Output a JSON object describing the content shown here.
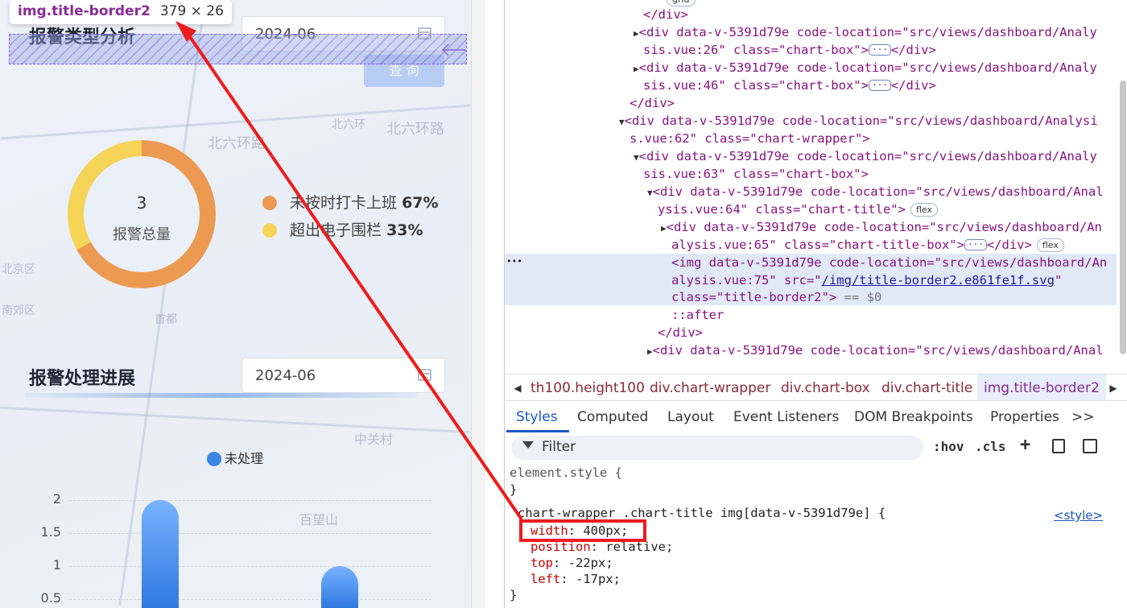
{
  "left": {
    "tooltip": {
      "selector": "img.title-border2",
      "size": "379 × 26"
    },
    "section1": {
      "title": "报警类型分析",
      "date": "2024-06",
      "query_label": "查 询"
    },
    "donut": {
      "total": "3",
      "total_label": "报警总量",
      "items": [
        {
          "label": "未按时打卡上班",
          "pct": "67%",
          "color": "#ec9a52",
          "value": 67
        },
        {
          "label": "超出电子围栏",
          "pct": "33%",
          "color": "#f5d458",
          "value": 33
        }
      ]
    },
    "section2": {
      "title": "报警处理进展",
      "date": "2024-06"
    },
    "map_labels": [
      "北六环路",
      "北六环路",
      "北六环",
      "南郊区",
      "北京区",
      "首都",
      "中关村",
      "百望山"
    ]
  },
  "chart_data": {
    "type": "bar",
    "series": [
      {
        "name": "未处理",
        "values": [
          2,
          1
        ]
      }
    ],
    "yticks": [
      "2",
      "1.5",
      "1",
      "0.5"
    ],
    "ylim": [
      0,
      2
    ],
    "color": "#3d86e8"
  },
  "devtools": {
    "dom": {
      "l0": "</div>",
      "l1a": "<div data-v-5391d79e code-location=\"src/views/dashboard/Analy",
      "l1b": "sis.vue:26\" class=\"chart-box\">",
      "l1c": "</div>",
      "l2a": "<div data-v-5391d79e code-location=\"src/views/dashboard/Analy",
      "l2b": "sis.vue:46\" class=\"chart-box\">",
      "l2c": "</div>",
      "l3": "</div>",
      "l4a": "<div data-v-5391d79e code-location=\"src/views/dashboard/Analysi",
      "l4b": "s.vue:62\" class=\"chart-wrapper\">",
      "l5a": "<div data-v-5391d79e code-location=\"src/views/dashboard/Analy",
      "l5b": "sis.vue:63\" class=\"chart-box\">",
      "l6a": "<div data-v-5391d79e code-location=\"src/views/dashboard/Anal",
      "l6b": "ysis.vue:64\" class=\"chart-title\">",
      "flex": "flex",
      "l7a": "<div data-v-5391d79e code-location=\"src/views/dashboard/An",
      "l7b": "alysis.vue:65\" class=\"chart-title-box\">",
      "l7c": "</div>",
      "l8a": "<img data-v-5391d79e code-location=\"src/views/dashboard/An",
      "l8b1": "alysis.vue:75\" src=\"",
      "l8link": "/img/title-border2.e861fe1f.svg",
      "l8b2": "\"",
      "l8c": "class=\"title-border2\">",
      "l8eq": " == $0",
      "l9": "::after",
      "l10": "</div>",
      "l11": "<div data-v-5391d79e code-location=\"src/views/dashboard/Anal",
      "dots": "•••",
      "grid": "grid"
    },
    "crumbs": [
      "th100.height100",
      "div.chart-wrapper",
      "div.chart-box",
      "div.chart-title",
      "img.title-border2"
    ],
    "tabs": [
      "Styles",
      "Computed",
      "Layout",
      "Event Listeners",
      "DOM Breakpoints",
      "Properties",
      ">>"
    ],
    "filter": {
      "placeholder": "Filter",
      "hov": ":hov",
      "cls": ".cls"
    },
    "css": {
      "elstyle": "element.style {",
      "close": "}",
      "selector": "chart-wrapper .chart-title img[data-v-5391d79e] {",
      "source": "<style>",
      "props": [
        {
          "n": "width",
          "v": "400px;"
        },
        {
          "n": "position",
          "v": "relative;"
        },
        {
          "n": "top",
          "v": "-22px;"
        },
        {
          "n": "left",
          "v": "-17px;"
        }
      ]
    }
  }
}
